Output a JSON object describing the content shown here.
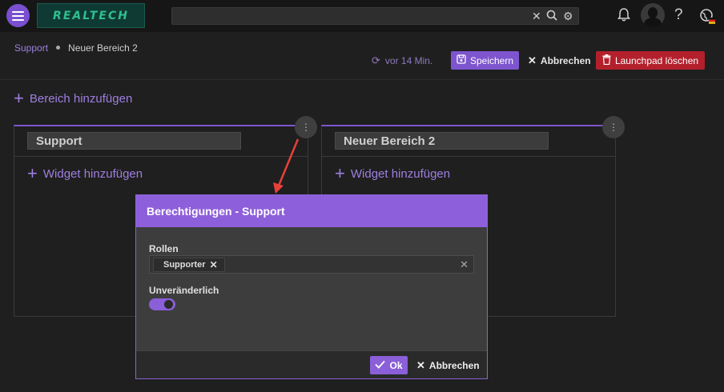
{
  "topbar": {
    "logo_text": "REALTECH",
    "search_value": "",
    "icons": [
      "menu-icon",
      "clear-icon",
      "search-icon",
      "gear-icon",
      "bell-icon",
      "avatar",
      "help-icon",
      "globe-icon"
    ]
  },
  "breadcrumb": {
    "parent": "Support",
    "current": "Neuer Bereich 2"
  },
  "toolbar": {
    "sync_text": "vor 14 Min.",
    "save_label": "Speichern",
    "cancel_label": "Abbrechen",
    "delete_label": "Launchpad löschen"
  },
  "add_area_label": "Bereich hinzufügen",
  "areas": [
    {
      "title": "Support",
      "add_widget_label": "Widget hinzufügen"
    },
    {
      "title": "Neuer Bereich 2",
      "add_widget_label": "Widget hinzufügen"
    }
  ],
  "dialog": {
    "title": "Berechtigungen - Support",
    "roles_label": "Rollen",
    "roles": [
      "Supporter"
    ],
    "immutable_label": "Unveränderlich",
    "immutable_on": true,
    "ok_label": "Ok",
    "cancel_label": "Abbrechen"
  },
  "colors": {
    "accent": "#8e5fdb",
    "danger": "#b3202c",
    "annotation_arrow": "#e8403a"
  }
}
